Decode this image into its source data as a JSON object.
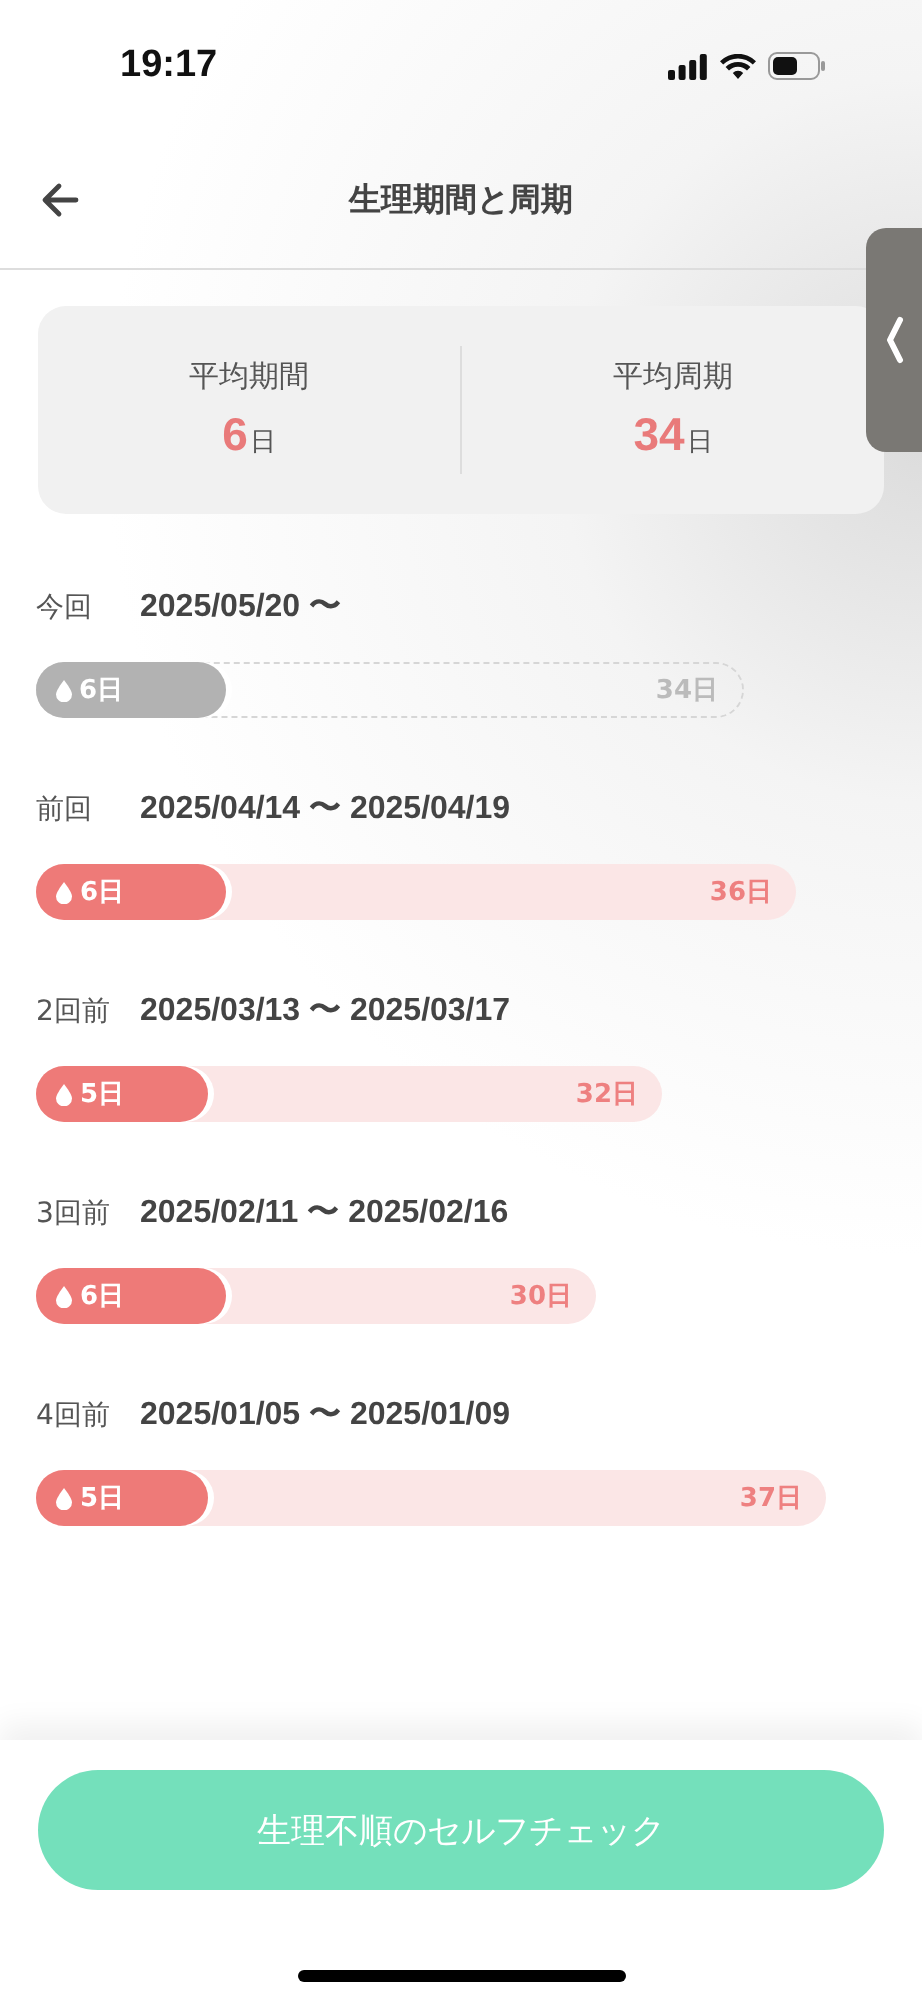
{
  "status_bar": {
    "time": "19:17"
  },
  "header": {
    "title": "生理期間と周期"
  },
  "summary": [
    {
      "label": "平均期間",
      "value": "6",
      "unit": "日"
    },
    {
      "label": "平均周期",
      "value": "34",
      "unit": "日"
    }
  ],
  "cycles": [
    {
      "kind": "current",
      "label": "今回",
      "dates": "2025/05/20 〜",
      "period_days": "6日",
      "cycle_days": "34日"
    },
    {
      "kind": "past",
      "label": "前回",
      "dates": "2025/04/14 〜 2025/04/19",
      "period_days": "6日",
      "cycle_days": "36日"
    },
    {
      "kind": "past",
      "label": "2回前",
      "dates": "2025/03/13 〜 2025/03/17",
      "period_days": "5日",
      "cycle_days": "32日"
    },
    {
      "kind": "past",
      "label": "3回前",
      "dates": "2025/02/11 〜 2025/02/16",
      "period_days": "6日",
      "cycle_days": "30日"
    },
    {
      "kind": "past",
      "label": "4回前",
      "dates": "2025/01/05 〜 2025/01/09",
      "period_days": "5日",
      "cycle_days": "37日"
    }
  ],
  "action_button": {
    "label": "生理不順のセルフチェック"
  }
}
